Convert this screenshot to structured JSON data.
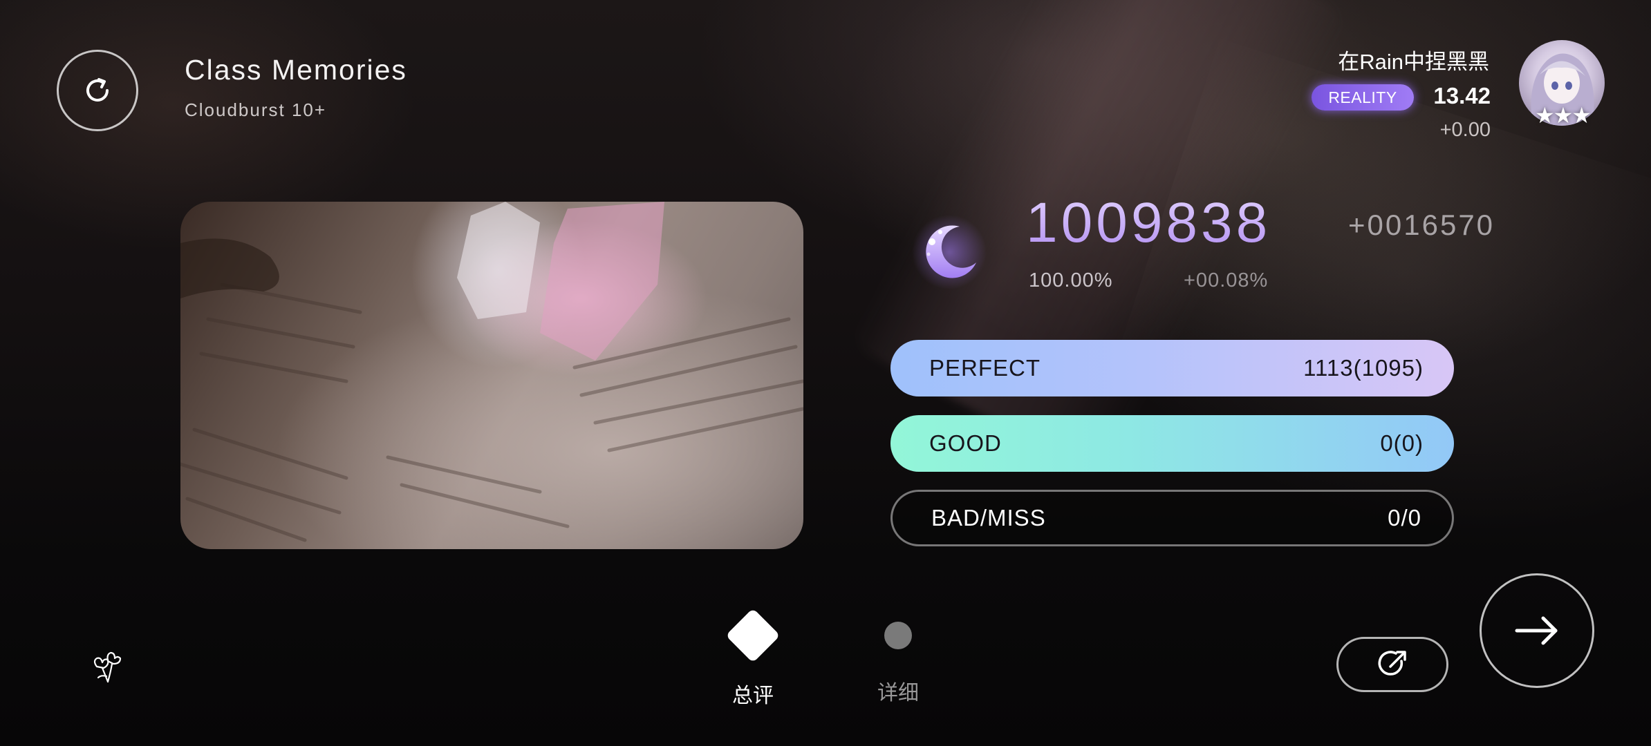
{
  "song": {
    "title": "Class Memories",
    "difficulty": "Cloudburst 10+"
  },
  "player": {
    "name": "在Rain中捏黑黑",
    "rank_badge": "REALITY",
    "rks": "13.42",
    "rks_delta": "+0.00",
    "avatar_stars": "★★★"
  },
  "result": {
    "score": "1009838",
    "score_delta": "+0016570",
    "accuracy": "100.00%",
    "accuracy_delta": "+00.08%",
    "grade_icon": "moon-icon"
  },
  "judgements": {
    "perfect": {
      "label": "PERFECT",
      "value": "1113(1095)"
    },
    "good": {
      "label": "GOOD",
      "value": "0(0)"
    },
    "bad_miss": {
      "label": "BAD/MISS",
      "value": "0/0"
    }
  },
  "tabs": {
    "summary": "总评",
    "detail": "详细",
    "active": "summary"
  },
  "icons": {
    "retry": "retry-icon",
    "share": "share-icon",
    "next": "arrow-right-icon",
    "flower": "flower-icon"
  },
  "colors": {
    "score_purple": "#c7a8f7",
    "perfect_bar": "#b4c3fb",
    "good_bar": "#8ee9e3",
    "rank_badge": "#8a64e8"
  }
}
